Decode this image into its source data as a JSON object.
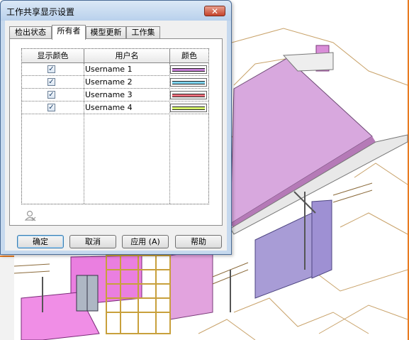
{
  "dialog": {
    "title": "工作共享显示设置",
    "close_label": "✕",
    "tabs": [
      {
        "label": "检出状态",
        "active": false
      },
      {
        "label": "所有者",
        "active": true
      },
      {
        "label": "模型更新",
        "active": false
      },
      {
        "label": "工作集",
        "active": false
      }
    ],
    "table": {
      "headers": {
        "show_color": "显示颜色",
        "username": "用户名",
        "color": "颜色"
      },
      "rows": [
        {
          "checked": true,
          "username": "Username 1",
          "color": "#c67ed6"
        },
        {
          "checked": true,
          "username": "Username 2",
          "color": "#7dd3ee"
        },
        {
          "checked": true,
          "username": "Username 3",
          "color": "#ef6d7a"
        },
        {
          "checked": true,
          "username": "Username 4",
          "color": "#d5f56a"
        }
      ]
    },
    "buttons": {
      "ok": "确定",
      "cancel": "取消",
      "apply": "应用 (A)",
      "help": "帮助"
    }
  },
  "icons": {
    "close": "close-icon",
    "lock": "user-lock-icon",
    "check": "checkmark-icon"
  },
  "colors": {
    "accent_border": "#4a6b96",
    "background_model_pink": "#ea7fe0",
    "background_model_purple": "#a89cd6"
  }
}
